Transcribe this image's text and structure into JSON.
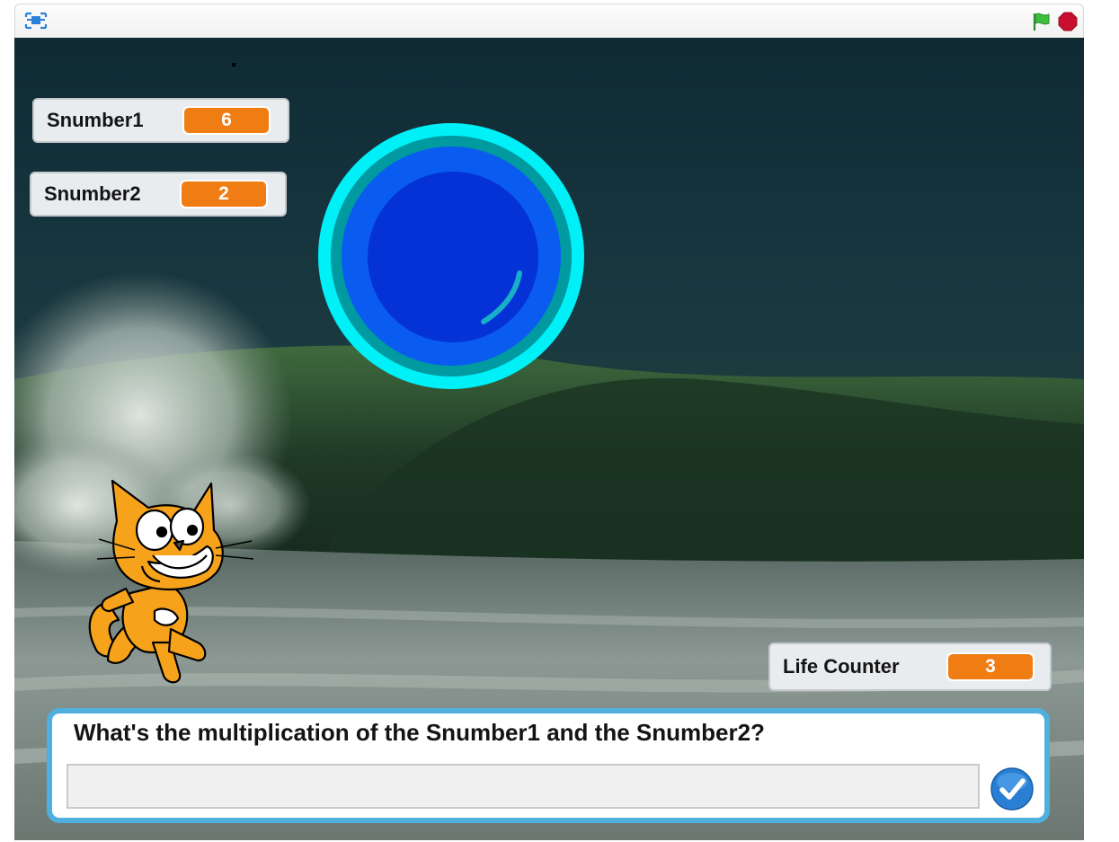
{
  "monitors": {
    "snumber1": {
      "label": "Snumber1",
      "value": "6"
    },
    "snumber2": {
      "label": "Snumber2",
      "value": "2"
    },
    "life_counter": {
      "label": "Life Counter",
      "value": "3"
    }
  },
  "ask": {
    "question": "What's the multiplication of the Snumber1 and the Snumber2?",
    "answer_value": ""
  },
  "icons": {
    "fullscreen": "fullscreen-icon",
    "green_flag": "green-flag-icon",
    "stop": "stop-sign-icon",
    "submit": "checkmark-icon"
  },
  "colors": {
    "monitor_value": "#f07c14",
    "ask_border": "#4fb0e0",
    "flag": "#2fb12f",
    "stop": "#c8102e"
  }
}
